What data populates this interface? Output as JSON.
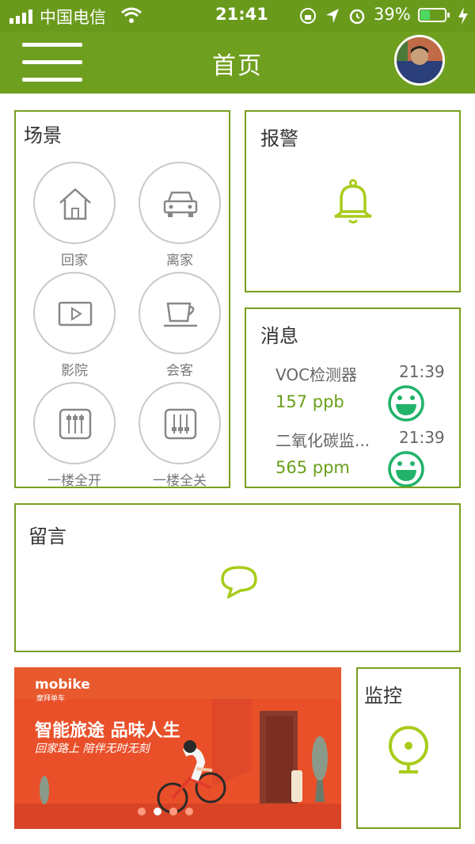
{
  "status_bar": {
    "carrier": "中国电信",
    "time": "21:41",
    "battery": "39%",
    "battery_level": 0.39
  },
  "header": {
    "title": "首页"
  },
  "scene": {
    "title": "场景",
    "items": [
      {
        "label": "回家",
        "icon": "home-icon"
      },
      {
        "label": "离家",
        "icon": "car-icon"
      },
      {
        "label": "影院",
        "icon": "play-icon"
      },
      {
        "label": "会客",
        "icon": "cup-icon"
      },
      {
        "label": "一楼全开",
        "icon": "sliders-on-icon"
      },
      {
        "label": "一楼全关",
        "icon": "sliders-off-icon"
      }
    ]
  },
  "alarm": {
    "title": "报警",
    "icon": "bell-icon"
  },
  "messages": {
    "title": "消息",
    "items": [
      {
        "name": "VOC检测器",
        "time": "21:39",
        "value": "157 ppb",
        "status_icon": "smile-icon"
      },
      {
        "name": "二氧化碳监...",
        "time": "21:39",
        "value": "565 ppm",
        "status_icon": "smile-icon"
      }
    ]
  },
  "leave_message": {
    "title": "留言",
    "icon": "chat-bubble-icon"
  },
  "ad_banner": {
    "brand": "mobike",
    "brand_sub": "摩拜单车",
    "headline": "智能旅途 品味人生",
    "subline": "回家路上 陪伴无时无刻"
  },
  "monitor": {
    "title": "监控",
    "icon": "camera-icon"
  },
  "colors": {
    "accent": "#6f9f1f",
    "icon_green": "#a8cc1a",
    "banner_bg": "#e9502a"
  }
}
